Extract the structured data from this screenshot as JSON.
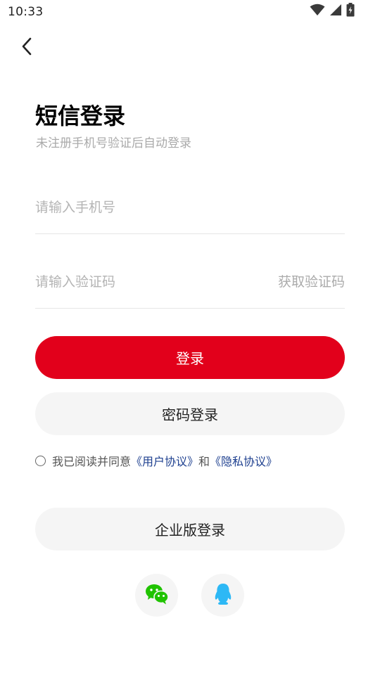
{
  "status_bar": {
    "time": "10:33",
    "icons": [
      "wifi-icon",
      "signal-icon",
      "battery-charging-icon"
    ]
  },
  "header": {
    "back_icon": "chevron-left-icon"
  },
  "main": {
    "title": "短信登录",
    "subtitle": "未注册手机号验证后自动登录",
    "phone_input": {
      "value": "",
      "placeholder": "请输入手机号"
    },
    "code_input": {
      "value": "",
      "placeholder": "请输入验证码"
    },
    "get_code_label": "获取验证码",
    "login_button": "登录",
    "password_login_button": "密码登录",
    "agreement": {
      "checked": false,
      "prefix": "我已阅读并同意",
      "user_agreement": "《用户协议》",
      "conjunction": "和",
      "privacy_policy": "《隐私协议》"
    },
    "enterprise_login_button": "企业版登录",
    "social_logins": [
      "wechat-icon",
      "qq-icon"
    ]
  },
  "colors": {
    "primary_red": "#e2001b",
    "link_blue": "#1d3f8f",
    "wechat_green": "#20c300",
    "qq_blue": "#2db8f5",
    "secondary_button_bg": "#f5f5f5",
    "placeholder_gray": "#b4b4b4"
  }
}
